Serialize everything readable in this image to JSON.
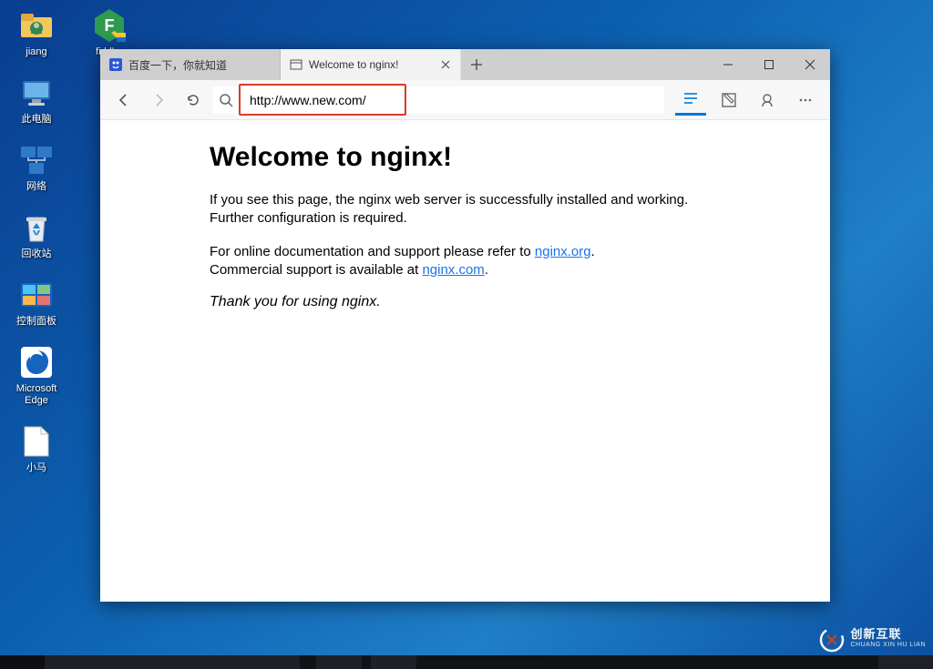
{
  "desktop": {
    "icons": [
      {
        "label": "jiang"
      },
      {
        "label": "此电脑"
      },
      {
        "label": "网络"
      },
      {
        "label": "回收站"
      },
      {
        "label": "控制面板"
      },
      {
        "label": "Microsoft Edge"
      },
      {
        "label": "小马"
      }
    ],
    "fiddler_label": "fiddler"
  },
  "browser": {
    "tabs": [
      {
        "title": "百度一下，你就知道",
        "active": false
      },
      {
        "title": "Welcome to nginx!",
        "active": true
      }
    ],
    "url": "http://www.new.com/",
    "page": {
      "heading": "Welcome to nginx!",
      "p1": "If you see this page, the nginx web server is successfully installed and working. Further configuration is required.",
      "p2a": "For online documentation and support please refer to ",
      "link1": "nginx.org",
      "p2b": ".",
      "p3a": "Commercial support is available at ",
      "link2": "nginx.com",
      "p3b": ".",
      "thanks": "Thank you for using nginx."
    }
  },
  "watermark": {
    "cn": "创新互联",
    "en": "CHUANG XIN HU LIAN"
  }
}
